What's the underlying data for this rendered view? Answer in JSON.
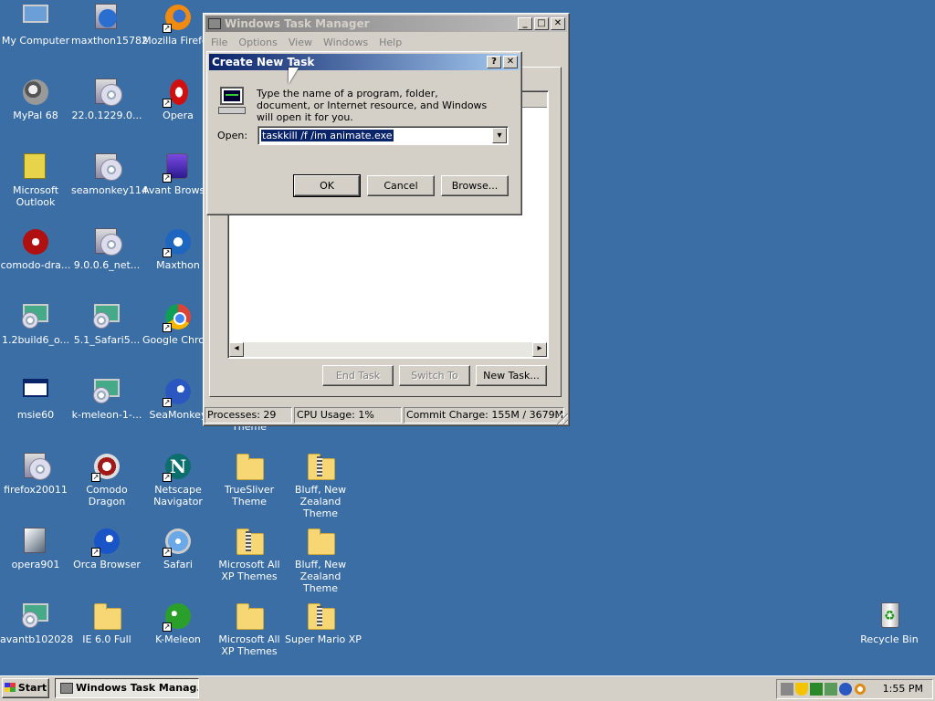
{
  "desktop": {
    "icons": [
      {
        "label": "My Computer"
      },
      {
        "label": "maxthon15782"
      },
      {
        "label": "Mozilla Firefox"
      },
      {
        "label": "MyPal 68"
      },
      {
        "label": "22.0.1229.0..."
      },
      {
        "label": "Opera"
      },
      {
        "label": "Microsoft Outlook"
      },
      {
        "label": "seamonkey114"
      },
      {
        "label": "Avant Browser"
      },
      {
        "label": "comodo-dra..."
      },
      {
        "label": "9.0.0.6_net..."
      },
      {
        "label": "Maxthon"
      },
      {
        "label": "1.2build6_o..."
      },
      {
        "label": "5.1_Safari5..."
      },
      {
        "label": "Google Chrome"
      },
      {
        "label": "msie60"
      },
      {
        "label": "k-meleon-1-..."
      },
      {
        "label": "SeaMonkey"
      },
      {
        "label": "firefox20011"
      },
      {
        "label": "Comodo Dragon"
      },
      {
        "label": "Netscape Navigator"
      },
      {
        "label": "TrueSliver Theme"
      },
      {
        "label": "Bluff, New Zealand Theme"
      },
      {
        "label": "opera901"
      },
      {
        "label": "Orca Browser"
      },
      {
        "label": "Safari"
      },
      {
        "label": "Microsoft All XP Themes"
      },
      {
        "label": "Bluff, New Zealand Theme"
      },
      {
        "label": "avantb102028"
      },
      {
        "label": "IE 6.0 Full"
      },
      {
        "label": "K-Meleon"
      },
      {
        "label": "Microsoft All XP Themes"
      },
      {
        "label": "Super Mario XP"
      },
      {
        "label": "Recycle Bin"
      },
      {
        "label": "Theme"
      }
    ]
  },
  "task_manager": {
    "title": "Windows Task Manager",
    "menu": [
      "File",
      "Options",
      "View",
      "Windows",
      "Help"
    ],
    "buttons": {
      "end_task": "End Task",
      "switch_to": "Switch To",
      "new_task": "New Task..."
    },
    "status": {
      "processes": "Processes: 29",
      "cpu": "CPU Usage: 1%",
      "commit": "Commit Charge: 155M / 3679M"
    }
  },
  "dialog": {
    "title": "Create New Task",
    "help_btn": "?",
    "close_btn": "✕",
    "description": "Type the name of a program, folder, document, or Internet resource, and Windows will open it for you.",
    "open_label": "Open:",
    "open_value": "taskkill /f /im animate.exe",
    "ok": "OK",
    "cancel": "Cancel",
    "browse": "Browse..."
  },
  "taskbar": {
    "start": "Start",
    "task_button": "Windows Task Manag...",
    "clock": "1:55 PM"
  }
}
